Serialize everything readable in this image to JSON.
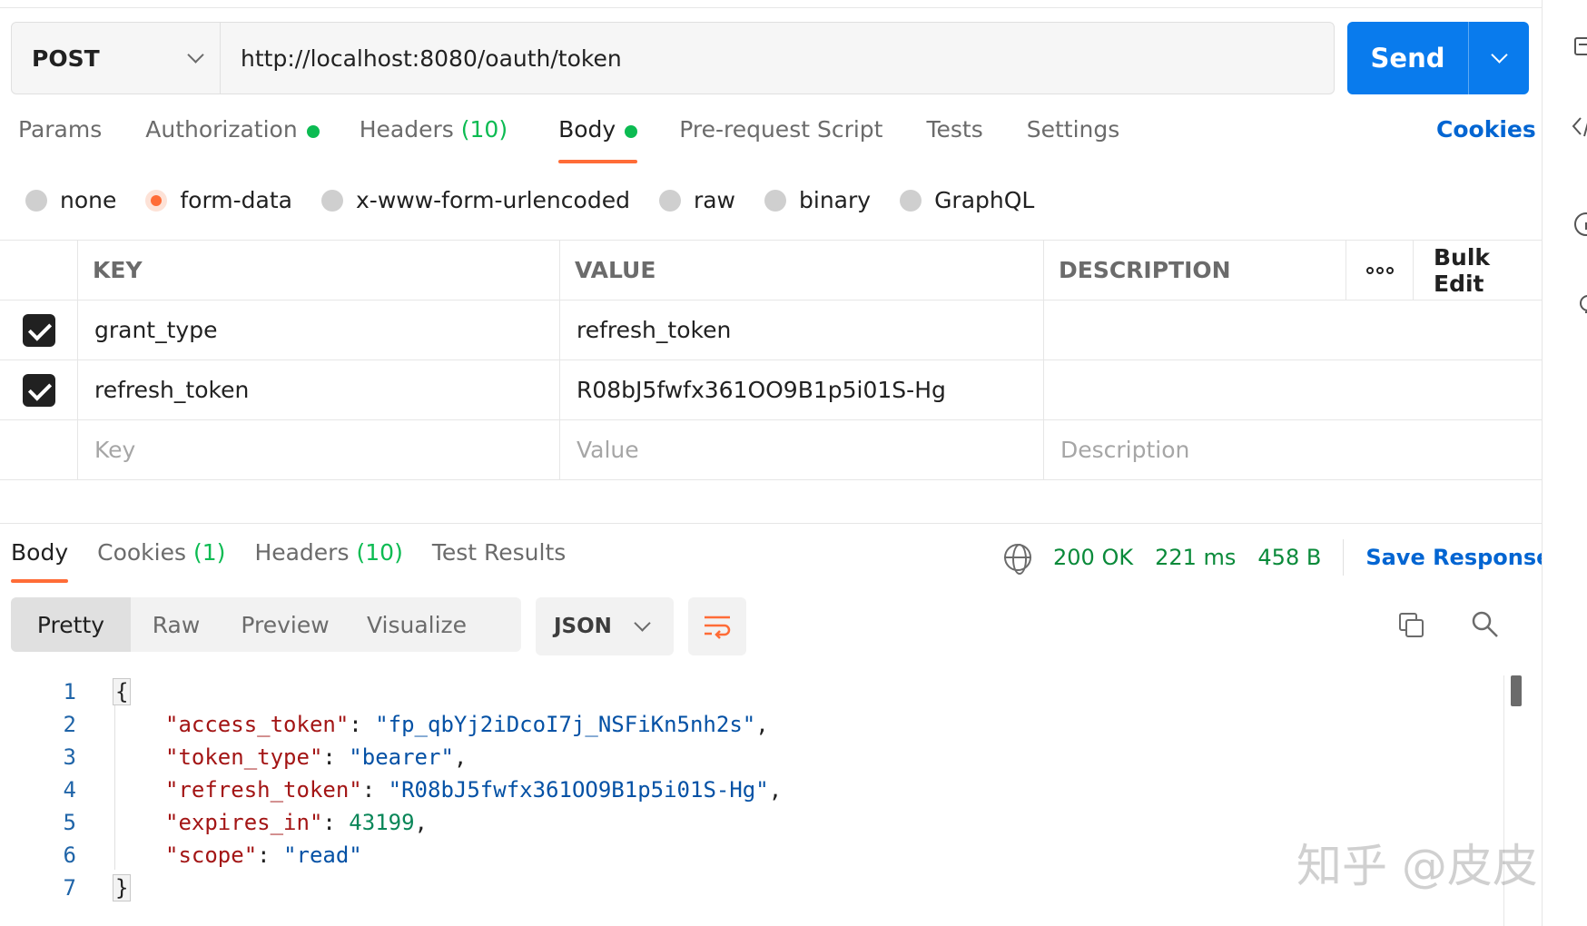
{
  "request": {
    "method": "POST",
    "url": "http://localhost:8080/oauth/token",
    "send_label": "Send"
  },
  "req_tabs": {
    "params": "Params",
    "authorization": "Authorization",
    "headers": "Headers",
    "headers_count": "(10)",
    "body": "Body",
    "prerequest": "Pre-request Script",
    "tests": "Tests",
    "settings": "Settings",
    "cookies": "Cookies"
  },
  "body_types": {
    "none": "none",
    "form_data": "form-data",
    "urlencoded": "x-www-form-urlencoded",
    "raw": "raw",
    "binary": "binary",
    "graphql": "GraphQL",
    "selected": "form-data"
  },
  "params_table": {
    "headers": {
      "key": "KEY",
      "value": "VALUE",
      "description": "DESCRIPTION",
      "bulk_edit": "Bulk Edit"
    },
    "rows": [
      {
        "checked": true,
        "key": "grant_type",
        "value": "refresh_token",
        "description": ""
      },
      {
        "checked": true,
        "key": "refresh_token",
        "value": "R08bJ5fwfx361OO9B1p5i01S-Hg",
        "description": ""
      }
    ],
    "placeholders": {
      "key": "Key",
      "value": "Value",
      "description": "Description"
    }
  },
  "response": {
    "tabs": {
      "body": "Body",
      "cookies": "Cookies",
      "cookies_count": "(1)",
      "headers": "Headers",
      "headers_count": "(10)",
      "test_results": "Test Results"
    },
    "status": "200 OK",
    "time": "221 ms",
    "size": "458 B",
    "save_response": "Save Response",
    "views": {
      "pretty": "Pretty",
      "raw": "Raw",
      "preview": "Preview",
      "visualize": "Visualize"
    },
    "format": "JSON",
    "code": {
      "line_numbers": [
        "1",
        "2",
        "3",
        "4",
        "5",
        "6",
        "7"
      ],
      "open_brace": "{",
      "close_brace": "}",
      "fields": [
        {
          "key": "\"access_token\"",
          "value": "\"fp_qbYj2iDcoI7j_NSFiKn5nh2s\"",
          "type": "string",
          "trail": ","
        },
        {
          "key": "\"token_type\"",
          "value": "\"bearer\"",
          "type": "string",
          "trail": ","
        },
        {
          "key": "\"refresh_token\"",
          "value": "\"R08bJ5fwfx361OO9B1p5i01S-Hg\"",
          "type": "string",
          "trail": ","
        },
        {
          "key": "\"expires_in\"",
          "value": "43199",
          "type": "number",
          "trail": ","
        },
        {
          "key": "\"scope\"",
          "value": "\"read\"",
          "type": "string",
          "trail": ""
        }
      ]
    }
  },
  "watermark": "知乎 @皮皮",
  "colors": {
    "accent_orange": "#ff6c37",
    "send_blue": "#097bed",
    "link_blue": "#0265d2",
    "status_green": "#0a8a3a",
    "count_green": "#0cbb52"
  }
}
